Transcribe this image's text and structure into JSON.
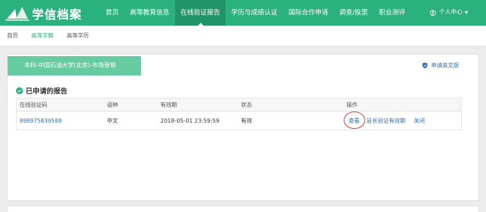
{
  "header": {
    "logo_text": "学信档案",
    "nav": [
      {
        "label": "首页"
      },
      {
        "label": "高等教育信息"
      },
      {
        "label": "在线验证报告"
      },
      {
        "label": "学历与成绩认证"
      },
      {
        "label": "国际合作申请"
      },
      {
        "label": "调查/投票"
      },
      {
        "label": "职业测评"
      }
    ],
    "user_menu": "个人中心"
  },
  "subnav": {
    "items": [
      {
        "label": "首页"
      },
      {
        "label": "高等学籍"
      },
      {
        "label": "高等学历"
      }
    ]
  },
  "panel": {
    "major": "本科-中国石油大学(北京)-市场营销",
    "apply_english": "申请英文版",
    "section_title": "已申请的报告",
    "table": {
      "headers": [
        "在线验证码",
        "语种",
        "有效期",
        "状态",
        "操作"
      ],
      "rows": [
        {
          "code": "998975839588",
          "language": "中文",
          "expiry": "2018-05-01 23:59:59",
          "status": "有效",
          "actions": {
            "view": "查看",
            "extend": "延长验证有效期",
            "close": "关闭"
          }
        }
      ]
    }
  },
  "colors": {
    "brand_green": "#2bb17e",
    "active_nav": "#21946a",
    "banner_green": "#66cba0",
    "link_blue": "#2a6fb3",
    "annotation_red": "#d9352b"
  }
}
